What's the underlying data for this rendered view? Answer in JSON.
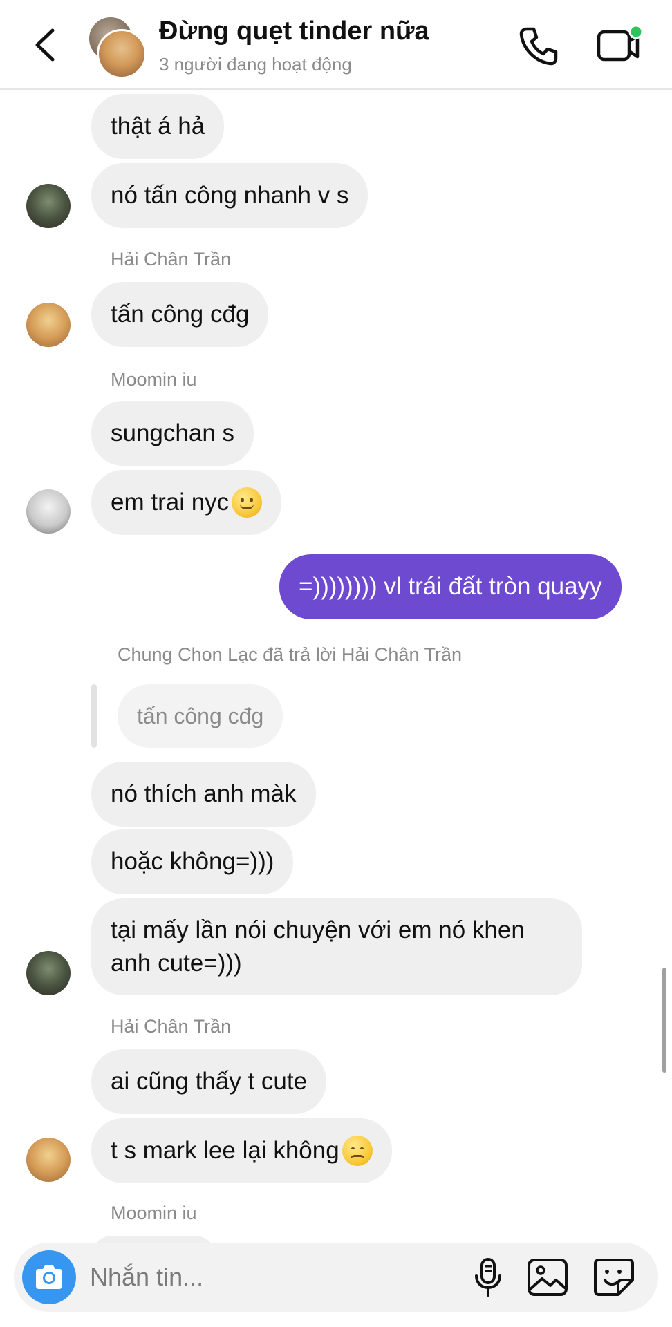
{
  "header": {
    "title": "Đừng quẹt tinder nữa",
    "subtitle": "3 người đang hoạt động",
    "icons": {
      "back": "chevron-left-icon",
      "call": "phone-icon",
      "video": "video-camera-icon"
    },
    "active_indicator_color": "#2fc35b"
  },
  "messages": [
    {
      "sender": "",
      "text": "thật á hả",
      "avatar": ""
    },
    {
      "sender": "",
      "text": "nó tấn công nhanh v s",
      "avatar": "dark"
    },
    {
      "sender": "Hải Chân Trần",
      "text": "tấn công cđg",
      "avatar": "blond"
    },
    {
      "sender": "Moomin iu",
      "text": "sungchan s",
      "avatar": ""
    },
    {
      "sender": "",
      "text": "em trai nyc",
      "emoji": "slightly-smiling-face",
      "avatar": "light"
    },
    {
      "sender": "me",
      "text": "=)))))))) vl trái đất tròn quayy",
      "outgoing": true
    },
    {
      "reply_notice": "Chung Chon Lạc đã trả lời Hải Chân Trần",
      "quoted": "tấn công cđg"
    },
    {
      "sender": "",
      "text": "nó thích anh màk",
      "avatar": ""
    },
    {
      "sender": "",
      "text": "hoặc không=)))",
      "avatar": ""
    },
    {
      "sender": "",
      "text": "tại mấy lần nói chuyện với em nó khen anh cute=)))",
      "avatar": "dark"
    },
    {
      "sender": "Hải Chân Trần",
      "text": "ai cũng thấy t cute",
      "avatar": ""
    },
    {
      "sender": "",
      "text": "t s mark lee lại không",
      "emoji": "pensive-face",
      "avatar": "blond"
    },
    {
      "sender": "Moomin iu",
      "text": ""
    }
  ],
  "composer": {
    "placeholder": "Nhắn tin...",
    "icons": [
      "camera-icon",
      "microphone-icon",
      "gallery-icon",
      "sticker-icon"
    ]
  },
  "colors": {
    "outgoing_bubble": "#6e4ad1",
    "incoming_bubble": "#efefef",
    "camera_button": "#3797f0"
  }
}
